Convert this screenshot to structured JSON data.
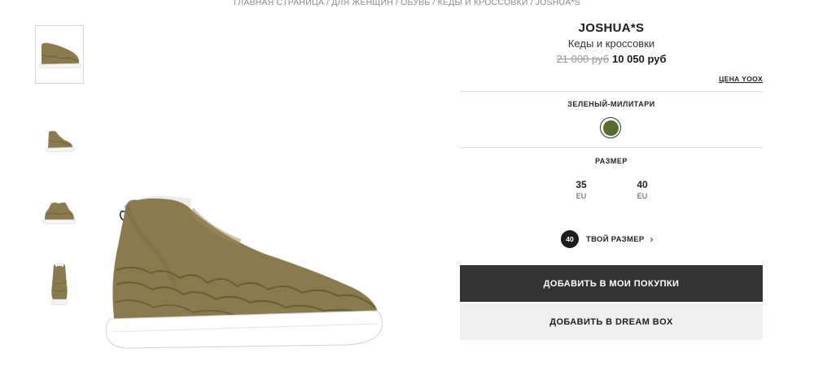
{
  "breadcrumb": {
    "items": [
      "ГЛАВНАЯ СТРАНИЦА",
      "ДЛЯ ЖЕНЩИН",
      "ОБУВЬ",
      "КЕДЫ И КРОССОВКИ",
      "JOSHUA*S"
    ],
    "separator": "/"
  },
  "thumbnails": [
    {
      "icon": "shoe-side-view",
      "active": true
    },
    {
      "icon": "shoe-side-view",
      "active": false
    },
    {
      "icon": "shoe-side-view",
      "active": false
    },
    {
      "icon": "shoe-front-view",
      "active": false
    }
  ],
  "product": {
    "brand": "JOSHUA*S",
    "category": "Кеды и кроссовки",
    "old_price": "21 000 руб",
    "new_price": "10 050 руб",
    "price_link": "ЦЕНА YOOX",
    "color_label": "ЗЕЛЕНЫЙ-МИЛИТАРИ",
    "color_hex": "#5a6a2e",
    "size_label": "РАЗМЕР",
    "sizes": [
      {
        "num": "35",
        "unit": "EU"
      },
      {
        "num": "40",
        "unit": "EU"
      }
    ],
    "your_size_badge": "40",
    "your_size_text": "ТВОЙ РАЗМЕР",
    "add_to_cart": "ДОБАВИТЬ В МОИ ПОКУПКИ",
    "add_to_dream_box": "ДОБАВИТЬ В DREAM BOX"
  },
  "colors": {
    "shoe_suede": "#8a7a4e",
    "sole": "#ffffff",
    "primary_button": "#333333",
    "secondary_button": "#efefef"
  }
}
